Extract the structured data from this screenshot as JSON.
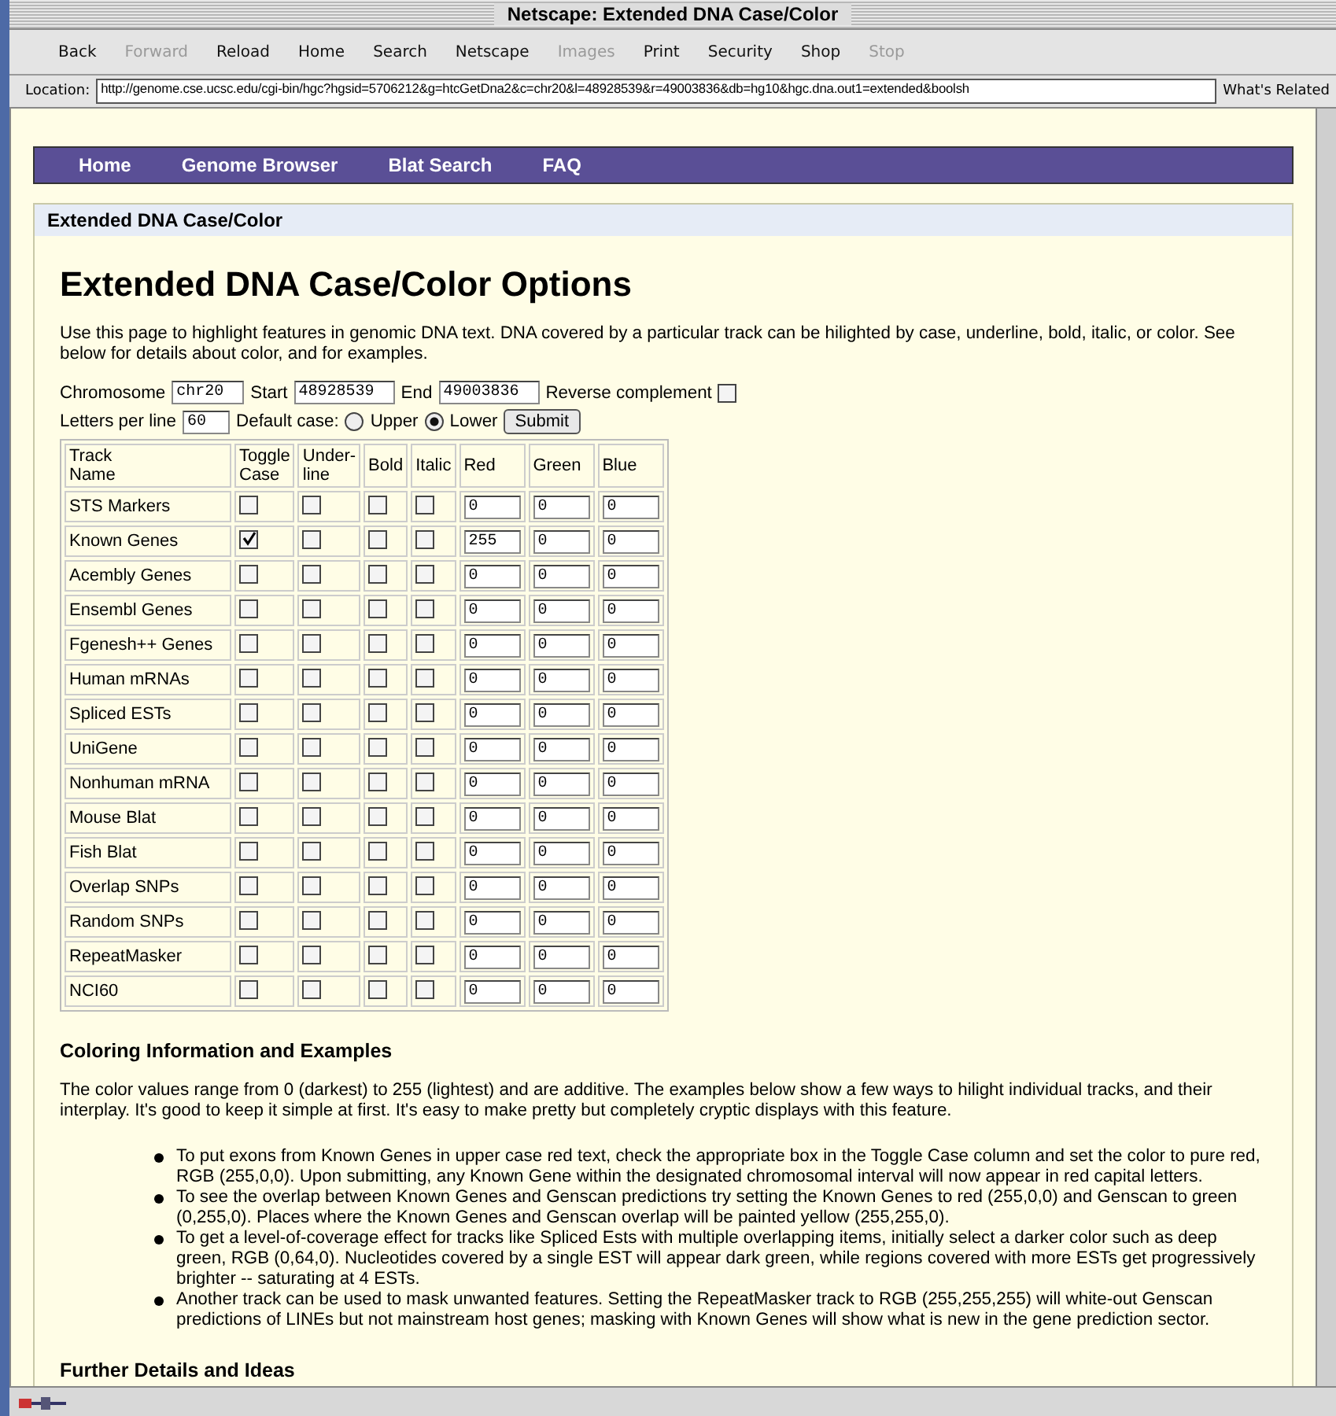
{
  "window": {
    "title": "Netscape: Extended DNA Case/Color"
  },
  "toolbar": [
    {
      "label": "Back",
      "disabled": false
    },
    {
      "label": "Forward",
      "disabled": true
    },
    {
      "label": "Reload",
      "disabled": false
    },
    {
      "label": "Home",
      "disabled": false
    },
    {
      "label": "Search",
      "disabled": false
    },
    {
      "label": "Netscape",
      "disabled": false
    },
    {
      "label": "Images",
      "disabled": true
    },
    {
      "label": "Print",
      "disabled": false
    },
    {
      "label": "Security",
      "disabled": false
    },
    {
      "label": "Shop",
      "disabled": false
    },
    {
      "label": "Stop",
      "disabled": true
    }
  ],
  "location": {
    "label": "Location:",
    "url": "http://genome.cse.ucsc.edu/cgi-bin/hgc?hgsid=5706212&g=htcGetDna2&c=chr20&l=48928539&r=49003836&db=hg10&hgc.dna.out1=extended&boolsh",
    "related": "What's Related"
  },
  "nav": [
    "Home",
    "Genome Browser",
    "Blat Search",
    "FAQ"
  ],
  "section_header": "Extended DNA Case/Color",
  "heading": "Extended DNA Case/Color Options",
  "intro": "Use this page to highlight features in genomic DNA text. DNA covered by a particular track can be hilighted by case, underline, bold, italic, or color. See below for details about color, and for examples.",
  "form": {
    "chromosome_label": "Chromosome",
    "chromosome": "chr20",
    "start_label": "Start",
    "start": "48928539",
    "end_label": "End",
    "end": "49003836",
    "reverse_label": "Reverse complement",
    "reverse": false,
    "letters_label": "Letters per line",
    "letters": "60",
    "case_label": "Default case:",
    "case_options": [
      {
        "label": "Upper",
        "selected": false
      },
      {
        "label": "Lower",
        "selected": true
      }
    ],
    "submit": "Submit"
  },
  "table": {
    "columns": [
      "Track Name",
      "Toggle Case",
      "Under- line",
      "Bold",
      "Italic",
      "Red",
      "Green",
      "Blue"
    ],
    "rows": [
      {
        "name": "STS Markers",
        "toggle_case": false,
        "underline": false,
        "bold": false,
        "italic": false,
        "red": "0",
        "green": "0",
        "blue": "0"
      },
      {
        "name": "Known Genes",
        "toggle_case": true,
        "underline": false,
        "bold": false,
        "italic": false,
        "red": "255",
        "green": "0",
        "blue": "0"
      },
      {
        "name": "Acembly Genes",
        "toggle_case": false,
        "underline": false,
        "bold": false,
        "italic": false,
        "red": "0",
        "green": "0",
        "blue": "0"
      },
      {
        "name": "Ensembl Genes",
        "toggle_case": false,
        "underline": false,
        "bold": false,
        "italic": false,
        "red": "0",
        "green": "0",
        "blue": "0"
      },
      {
        "name": "Fgenesh++ Genes",
        "toggle_case": false,
        "underline": false,
        "bold": false,
        "italic": false,
        "red": "0",
        "green": "0",
        "blue": "0"
      },
      {
        "name": "Human mRNAs",
        "toggle_case": false,
        "underline": false,
        "bold": false,
        "italic": false,
        "red": "0",
        "green": "0",
        "blue": "0"
      },
      {
        "name": "Spliced ESTs",
        "toggle_case": false,
        "underline": false,
        "bold": false,
        "italic": false,
        "red": "0",
        "green": "0",
        "blue": "0"
      },
      {
        "name": "UniGene",
        "toggle_case": false,
        "underline": false,
        "bold": false,
        "italic": false,
        "red": "0",
        "green": "0",
        "blue": "0"
      },
      {
        "name": "Nonhuman mRNA",
        "toggle_case": false,
        "underline": false,
        "bold": false,
        "italic": false,
        "red": "0",
        "green": "0",
        "blue": "0"
      },
      {
        "name": "Mouse Blat",
        "toggle_case": false,
        "underline": false,
        "bold": false,
        "italic": false,
        "red": "0",
        "green": "0",
        "blue": "0"
      },
      {
        "name": "Fish Blat",
        "toggle_case": false,
        "underline": false,
        "bold": false,
        "italic": false,
        "red": "0",
        "green": "0",
        "blue": "0"
      },
      {
        "name": "Overlap SNPs",
        "toggle_case": false,
        "underline": false,
        "bold": false,
        "italic": false,
        "red": "0",
        "green": "0",
        "blue": "0"
      },
      {
        "name": "Random SNPs",
        "toggle_case": false,
        "underline": false,
        "bold": false,
        "italic": false,
        "red": "0",
        "green": "0",
        "blue": "0"
      },
      {
        "name": "RepeatMasker",
        "toggle_case": false,
        "underline": false,
        "bold": false,
        "italic": false,
        "red": "0",
        "green": "0",
        "blue": "0"
      },
      {
        "name": "NCI60",
        "toggle_case": false,
        "underline": false,
        "bold": false,
        "italic": false,
        "red": "0",
        "green": "0",
        "blue": "0"
      }
    ]
  },
  "coloring": {
    "heading": "Coloring Information and Examples",
    "paragraph": "The color values range from 0 (darkest) to 255 (lightest) and are additive. The examples below show a few ways to hilight individual tracks, and their interplay. It's good to keep it simple at first. It's easy to make pretty but completely cryptic displays with this feature.",
    "bullets": [
      "To put exons from Known Genes in upper case red text, check the appropriate box in the Toggle Case column and set the color to pure red, RGB (255,0,0). Upon submitting, any Known Gene within the designated chromosomal interval will now appear in red capital letters.",
      "To see the overlap between Known Genes and Genscan predictions try setting the Known Genes to red (255,0,0) and Genscan to green (0,255,0). Places where the Known Genes and Genscan overlap will be painted yellow (255,255,0).",
      "To get a level-of-coverage effect for tracks like Spliced Ests with multiple overlapping items, initially select a darker color such as deep green, RGB (0,64,0). Nucleotides covered by a single EST will appear dark green, while regions covered with more ESTs get progressively brighter -- saturating at 4 ESTs.",
      "Another track can be used to mask unwanted features. Setting the RepeatMasker track to RGB (255,255,255) will white-out Genscan predictions of LINEs but not mainstream host genes; masking with Known Genes will show what is new in the gene prediction sector."
    ]
  },
  "further_heading": "Further Details and Ideas"
}
